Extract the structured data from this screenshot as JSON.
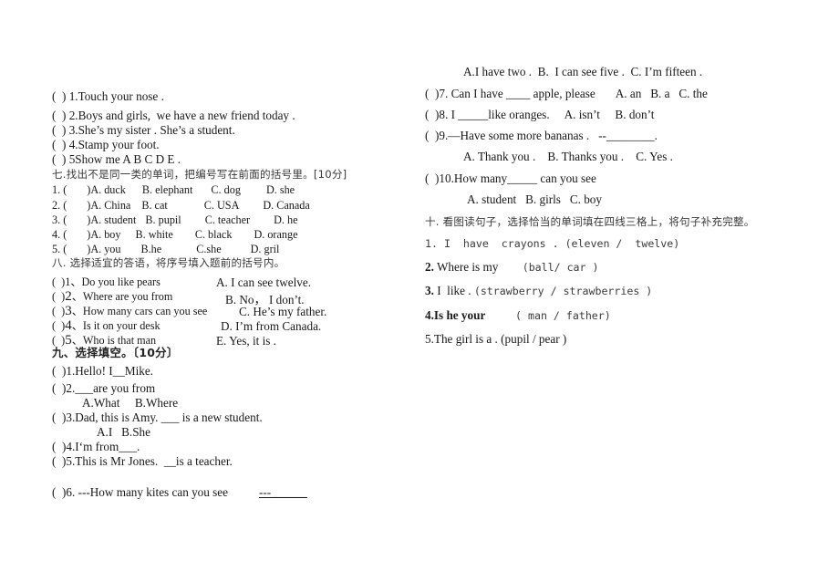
{
  "document": {
    "type": "printed-exam-worksheet",
    "page_background": "#ffffff",
    "text_color": "#181818"
  },
  "left_column": {
    "listening_items": [
      {
        "bracket": "(  )",
        "text": "1.Touch your nose ."
      },
      {
        "bracket": "(  )",
        "text": "2.Boys and girls,  we have a new friend today ."
      },
      {
        "bracket": "(  )",
        "text": "3.She’s my sister . She’s a student."
      },
      {
        "bracket": "(  )",
        "text": "4.Stamp your foot."
      },
      {
        "bracket": "(  )",
        "text": "5Show me A B C D E ."
      }
    ],
    "section_seven": {
      "heading": "七.找出不是同一类的单词，把编号写在前面的括号里。[10分]",
      "items": [
        {
          "num": "1. (",
          "close": ")",
          "a": "A. duck",
          "b": "B. elephant",
          "c": "C. dog",
          "d": "D. she"
        },
        {
          "num": "2. (",
          "close": ")",
          "a": "A. China",
          "b": "B. cat",
          "c": "C. USA",
          "d": "D. Canada"
        },
        {
          "num": "3. (",
          "close": ")",
          "a": "A. student",
          "b": "B. pupil",
          "c": "C. teacher",
          "d": "D. he"
        },
        {
          "num": "4. (",
          "close": ")",
          "a": "A. boy",
          "b": "B. white",
          "c": "C. black",
          "d": "D. orange"
        },
        {
          "num": "5. (",
          "close": ")",
          "a": "A. you",
          "b": "B.he",
          "c": "C.she",
          "d": "D. gril"
        }
      ]
    },
    "section_eight": {
      "heading": "八. 选择适宜的答语，将序号填入题前的括号内。",
      "items": [
        {
          "bracket": "(  )",
          "num": "1",
          "sep": "、",
          "question": "Do you like pears",
          "answer": "A. I can see twelve."
        },
        {
          "bracket": "(  )",
          "num": "2",
          "sep": "、",
          "question": "Where are you from",
          "answer": "B. No， I don’t."
        },
        {
          "bracket": "(  )",
          "num": "3",
          "sep": "、",
          "question": "How many cars can you see",
          "answer": "C. He’s my father."
        },
        {
          "bracket": "(  )",
          "num": "4",
          "sep": "、",
          "question": "Is it on your desk",
          "answer": "D. I’m from Canada."
        },
        {
          "bracket": "(  )",
          "num": "5",
          "sep": "、",
          "question": "Who is that man",
          "answer": "E. Yes, it is ."
        }
      ]
    },
    "section_nine": {
      "heading": "九、选择填空。〔10分〕",
      "items": [
        {
          "bracket": "(  )",
          "text": "1.Hello! I__Mike.",
          "choices": ""
        },
        {
          "bracket": "(  )",
          "text": "2.___are you from",
          "choices": "A.What     B.Where"
        },
        {
          "bracket": "(  )",
          "text": "3.Dad, this is Amy. ___ is a new student.",
          "choices": "A.I   B.She"
        },
        {
          "bracket": "(  )",
          "text": "4.I‘m from___.",
          "choices": ""
        },
        {
          "bracket": "(  )",
          "text": "5.This is Mr Jones.  __is a teacher.",
          "choices": ""
        },
        {
          "bracket": "(  )",
          "text": "6. ---How many kites can you see",
          "choices": "",
          "trailing": "---______"
        }
      ]
    }
  },
  "right_column": {
    "carryover_choices": "A.I have two .  B.  I can see five .  C. I’m fifteen .",
    "section_nine_continued": [
      {
        "bracket": "(  )",
        "text": "7. Can I have ____ apple, please",
        "choices": "A. an   B. a   C. the"
      },
      {
        "bracket": "(  )",
        "text": "8. I _____like oranges.",
        "choices": "A. isn’t     B. don’t"
      },
      {
        "bracket": "(  )",
        "text": "9.—Have some more bananas .   --________.",
        "choices": ""
      },
      {
        "bracket": "",
        "text": "",
        "choices": "A. Thank you .    B. Thanks you .    C. Yes ."
      },
      {
        "bracket": "(  )",
        "text": "10.How many_____ can you see",
        "choices": ""
      },
      {
        "bracket": "",
        "text": "",
        "choices": "A. student   B. girls   C. boy"
      }
    ],
    "section_ten": {
      "heading": "十. 看图读句子，选择恰当的单词填在四线三格上，将句子补充完整。",
      "items": [
        {
          "num": "1.",
          "sentence": " I  have  crayons . ",
          "options": "(eleven /  twelve)",
          "sentence_style": "mono"
        },
        {
          "num": "2.",
          "sentence": " Where is my        ",
          "options": "(ball/ car )",
          "sentence_style": "serif"
        },
        {
          "num": "3.",
          "sentence": " I  like . ",
          "options": "(strawberry / strawberries )",
          "sentence_style": "serif"
        },
        {
          "num": "4.",
          "sentence": "Is he your          ",
          "options": "( man / father)",
          "sentence_style": "serif"
        },
        {
          "num": "5.",
          "sentence": "The girl is a . ",
          "options": "(pupil / pear )",
          "sentence_style": "serif"
        }
      ]
    }
  }
}
